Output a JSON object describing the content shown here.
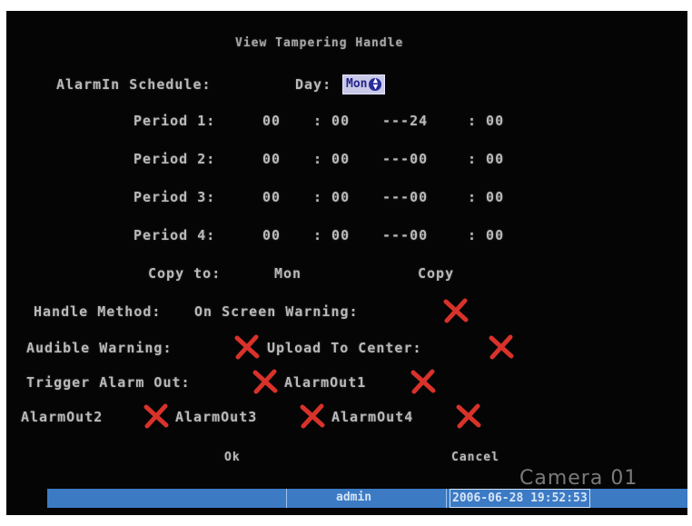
{
  "title": "View Tampering Handle",
  "schedule": {
    "label": "AlarmIn Schedule:",
    "day_label": "Day:",
    "day_value": "Mon"
  },
  "periods": [
    {
      "label": "Period 1:",
      "start_h": "00",
      "start_m": ": 00",
      "end_h": "---24",
      "end_m": ": 00"
    },
    {
      "label": "Period 2:",
      "start_h": "00",
      "start_m": ": 00",
      "end_h": "---00",
      "end_m": ": 00"
    },
    {
      "label": "Period 3:",
      "start_h": "00",
      "start_m": ": 00",
      "end_h": "---00",
      "end_m": ": 00"
    },
    {
      "label": "Period 4:",
      "start_h": "00",
      "start_m": ": 00",
      "end_h": "---00",
      "end_m": ": 00"
    }
  ],
  "copy": {
    "label": "Copy to:",
    "value": "Mon",
    "button": "Copy"
  },
  "handle": {
    "method_label": "Handle Method:",
    "on_screen_label": "On Screen Warning:",
    "audible_label": "Audible Warning:",
    "upload_label": "Upload To Center:",
    "trigger_label": "Trigger Alarm Out:",
    "alarm_out1": "AlarmOut1",
    "alarm_out2": "AlarmOut2",
    "alarm_out3": "AlarmOut3",
    "alarm_out4": "AlarmOut4"
  },
  "buttons": {
    "ok": "Ok",
    "cancel": "Cancel"
  },
  "camera_label": "Camera 01",
  "status": {
    "user": "admin",
    "datetime": "2006-06-28 19:52:53"
  },
  "colors": {
    "check_mark": "#d8322a",
    "status_bar": "#3c7ac4",
    "screen_bg": "#050506"
  },
  "icons": [
    "x-mark-icon",
    "spin-arrows-icon"
  ]
}
